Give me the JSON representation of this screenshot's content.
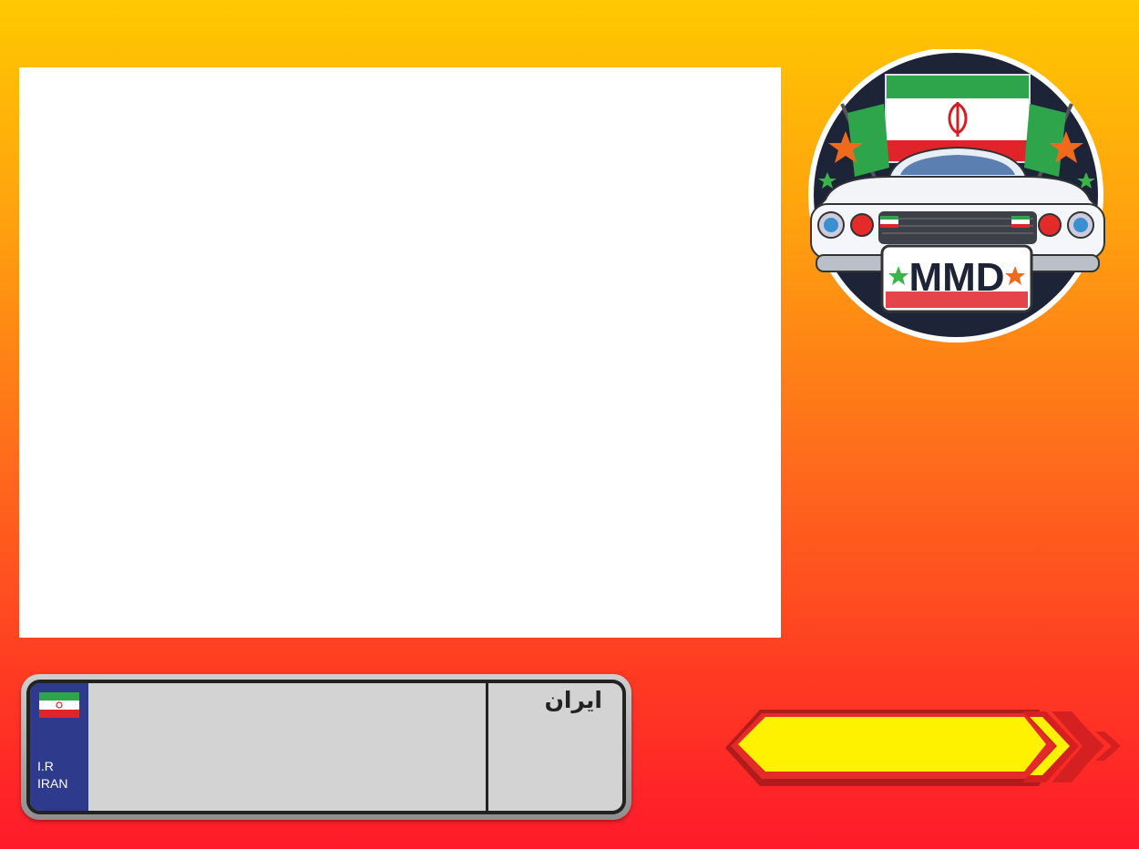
{
  "logo": {
    "text": "MMD",
    "icon": "car-with-iran-flags-logo"
  },
  "plate": {
    "country_code": "I.R",
    "country_name": "IRAN",
    "region_label": "ایران",
    "number": "",
    "flag_icon": "iran-flag-icon"
  },
  "action": {
    "label": "",
    "icon": "double-chevron-right-icon"
  },
  "colors": {
    "background_top": "#ffc800",
    "background_bottom": "#ff1a2a",
    "plate_blue": "#2e3a8c",
    "button_fill": "#fff200",
    "button_border": "#d42020"
  }
}
